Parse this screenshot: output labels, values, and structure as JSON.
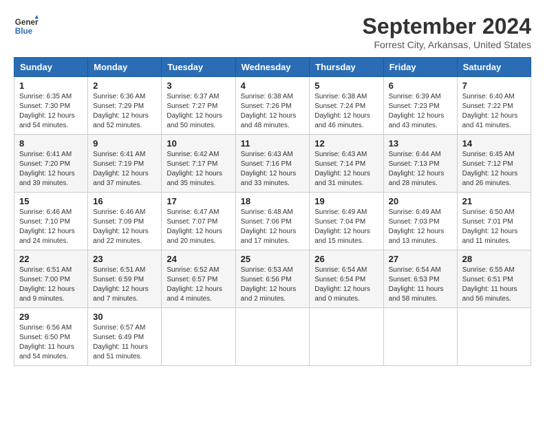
{
  "header": {
    "logo_line1": "General",
    "logo_line2": "Blue",
    "month_title": "September 2024",
    "location": "Forrest City, Arkansas, United States"
  },
  "days_of_week": [
    "Sunday",
    "Monday",
    "Tuesday",
    "Wednesday",
    "Thursday",
    "Friday",
    "Saturday"
  ],
  "weeks": [
    [
      {
        "day": "1",
        "sunrise": "6:35 AM",
        "sunset": "7:30 PM",
        "daylight": "12 hours and 54 minutes."
      },
      {
        "day": "2",
        "sunrise": "6:36 AM",
        "sunset": "7:29 PM",
        "daylight": "12 hours and 52 minutes."
      },
      {
        "day": "3",
        "sunrise": "6:37 AM",
        "sunset": "7:27 PM",
        "daylight": "12 hours and 50 minutes."
      },
      {
        "day": "4",
        "sunrise": "6:38 AM",
        "sunset": "7:26 PM",
        "daylight": "12 hours and 48 minutes."
      },
      {
        "day": "5",
        "sunrise": "6:38 AM",
        "sunset": "7:24 PM",
        "daylight": "12 hours and 46 minutes."
      },
      {
        "day": "6",
        "sunrise": "6:39 AM",
        "sunset": "7:23 PM",
        "daylight": "12 hours and 43 minutes."
      },
      {
        "day": "7",
        "sunrise": "6:40 AM",
        "sunset": "7:22 PM",
        "daylight": "12 hours and 41 minutes."
      }
    ],
    [
      {
        "day": "8",
        "sunrise": "6:41 AM",
        "sunset": "7:20 PM",
        "daylight": "12 hours and 39 minutes."
      },
      {
        "day": "9",
        "sunrise": "6:41 AM",
        "sunset": "7:19 PM",
        "daylight": "12 hours and 37 minutes."
      },
      {
        "day": "10",
        "sunrise": "6:42 AM",
        "sunset": "7:17 PM",
        "daylight": "12 hours and 35 minutes."
      },
      {
        "day": "11",
        "sunrise": "6:43 AM",
        "sunset": "7:16 PM",
        "daylight": "12 hours and 33 minutes."
      },
      {
        "day": "12",
        "sunrise": "6:43 AM",
        "sunset": "7:14 PM",
        "daylight": "12 hours and 31 minutes."
      },
      {
        "day": "13",
        "sunrise": "6:44 AM",
        "sunset": "7:13 PM",
        "daylight": "12 hours and 28 minutes."
      },
      {
        "day": "14",
        "sunrise": "6:45 AM",
        "sunset": "7:12 PM",
        "daylight": "12 hours and 26 minutes."
      }
    ],
    [
      {
        "day": "15",
        "sunrise": "6:46 AM",
        "sunset": "7:10 PM",
        "daylight": "12 hours and 24 minutes."
      },
      {
        "day": "16",
        "sunrise": "6:46 AM",
        "sunset": "7:09 PM",
        "daylight": "12 hours and 22 minutes."
      },
      {
        "day": "17",
        "sunrise": "6:47 AM",
        "sunset": "7:07 PM",
        "daylight": "12 hours and 20 minutes."
      },
      {
        "day": "18",
        "sunrise": "6:48 AM",
        "sunset": "7:06 PM",
        "daylight": "12 hours and 17 minutes."
      },
      {
        "day": "19",
        "sunrise": "6:49 AM",
        "sunset": "7:04 PM",
        "daylight": "12 hours and 15 minutes."
      },
      {
        "day": "20",
        "sunrise": "6:49 AM",
        "sunset": "7:03 PM",
        "daylight": "12 hours and 13 minutes."
      },
      {
        "day": "21",
        "sunrise": "6:50 AM",
        "sunset": "7:01 PM",
        "daylight": "12 hours and 11 minutes."
      }
    ],
    [
      {
        "day": "22",
        "sunrise": "6:51 AM",
        "sunset": "7:00 PM",
        "daylight": "12 hours and 9 minutes."
      },
      {
        "day": "23",
        "sunrise": "6:51 AM",
        "sunset": "6:59 PM",
        "daylight": "12 hours and 7 minutes."
      },
      {
        "day": "24",
        "sunrise": "6:52 AM",
        "sunset": "6:57 PM",
        "daylight": "12 hours and 4 minutes."
      },
      {
        "day": "25",
        "sunrise": "6:53 AM",
        "sunset": "6:56 PM",
        "daylight": "12 hours and 2 minutes."
      },
      {
        "day": "26",
        "sunrise": "6:54 AM",
        "sunset": "6:54 PM",
        "daylight": "12 hours and 0 minutes."
      },
      {
        "day": "27",
        "sunrise": "6:54 AM",
        "sunset": "6:53 PM",
        "daylight": "11 hours and 58 minutes."
      },
      {
        "day": "28",
        "sunrise": "6:55 AM",
        "sunset": "6:51 PM",
        "daylight": "11 hours and 56 minutes."
      }
    ],
    [
      {
        "day": "29",
        "sunrise": "6:56 AM",
        "sunset": "6:50 PM",
        "daylight": "11 hours and 54 minutes."
      },
      {
        "day": "30",
        "sunrise": "6:57 AM",
        "sunset": "6:49 PM",
        "daylight": "11 hours and 51 minutes."
      },
      null,
      null,
      null,
      null,
      null
    ]
  ]
}
